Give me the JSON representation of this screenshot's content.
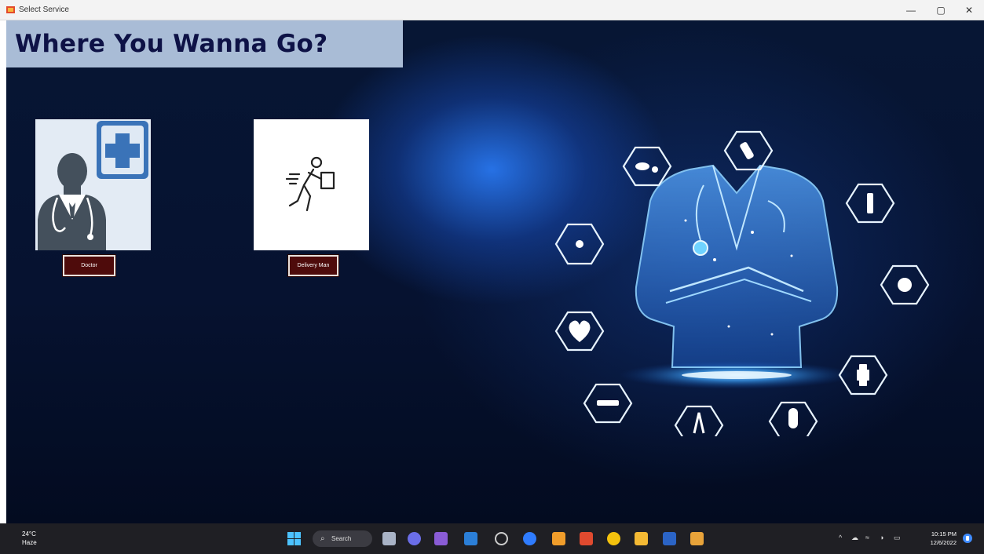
{
  "window": {
    "title": "Select Service",
    "controls": {
      "minimize": "—",
      "maximize": "▢",
      "close": "✕"
    }
  },
  "app": {
    "heading": "Where You Wanna Go?",
    "services": [
      {
        "label": "Doctor",
        "icon": "doctor-icon"
      },
      {
        "label": "Delivery Man",
        "icon": "delivery-man-icon"
      }
    ],
    "colors": {
      "banner": "#a9bcd6",
      "heading": "#0e1246",
      "button": "#4e0b0b",
      "background": "#061230"
    }
  },
  "taskbar": {
    "weather_temp": "24°C",
    "weather_desc": "Haze",
    "search_label": "Search",
    "apps": [
      "start-icon",
      "taskview-icon",
      "chat-icon",
      "visual-studio-icon",
      "vscode-icon",
      "chrome-dev-icon",
      "messenger-icon",
      "edge-icon",
      "sublime-icon",
      "brave-icon",
      "chrome-icon",
      "file-explorer-icon",
      "word-icon",
      "java-app-icon"
    ],
    "tray": {
      "chevron": "^",
      "onedrive": "☁",
      "wifi": "≈",
      "volume": "◑",
      "battery": "▭"
    },
    "time": "10:15 PM",
    "date": "12/6/2022"
  }
}
